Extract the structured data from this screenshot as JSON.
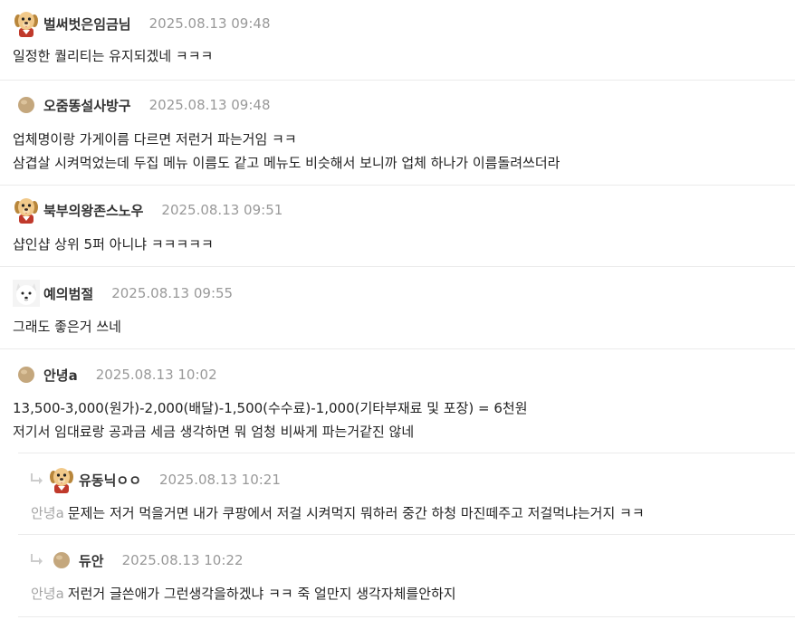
{
  "comments": [
    {
      "nick": "벌써벗은임금님",
      "date": "2025.08.13 09:48",
      "avatar": "dog-avatar",
      "lines": [
        "일정한 퀄리티는 유지되겠네 ㅋㅋㅋ"
      ]
    },
    {
      "nick": "오줌똥설사방구",
      "date": "2025.08.13 09:48",
      "avatar": "default-avatar",
      "lines": [
        "업체명이랑 가게이름 다르면 저런거 파는거임 ㅋㅋ",
        "삼겹살 시켜먹었는데 두집 메뉴 이름도 같고 메뉴도 비슷해서 보니까 업체 하나가 이름돌려쓰더라"
      ]
    },
    {
      "nick": "북부의왕존스노우",
      "date": "2025.08.13 09:51",
      "avatar": "dog-avatar",
      "lines": [
        "샵인샵 상위 5퍼 아니냐 ㅋㅋㅋㅋㅋ"
      ]
    },
    {
      "nick": "예의범절",
      "date": "2025.08.13 09:55",
      "avatar": "white-dog-avatar",
      "lines": [
        "그래도 좋은거 쓰네"
      ]
    },
    {
      "nick": "안녕a",
      "date": "2025.08.13 10:02",
      "avatar": "default-avatar",
      "lines": [
        "13,500-3,000(원가)-2,000(배달)-1,500(수수료)-1,000(기타부재료 및 포장) = 6천원",
        "저기서 임대료랑 공과금 세금 생각하면 뭐 엄청 비싸게 파는거같진 않네"
      ]
    }
  ],
  "replies": [
    {
      "nick": "유동닉ㅇㅇ",
      "date": "2025.08.13 10:21",
      "avatar": "dog-avatar",
      "mention": "안녕a",
      "text": "문제는 저거 먹을거면 내가 쿠팡에서 저걸 시켜먹지 뭐하러 중간 하청 마진떼주고 저걸먹냐는거지 ㅋㅋ"
    },
    {
      "nick": "듀안",
      "date": "2025.08.13 10:22",
      "avatar": "default-avatar",
      "mention": "안녕a",
      "text": "저런거 글쓴애가 그런생각을하겠냐 ㅋㅋ 죽 얼만지 생각자체를안하지"
    }
  ],
  "colors": {
    "nick": "#333333",
    "date": "#999999",
    "mention": "#a5a5a5",
    "divider": "#ebebeb",
    "default_avatar": "#c4a77d"
  }
}
